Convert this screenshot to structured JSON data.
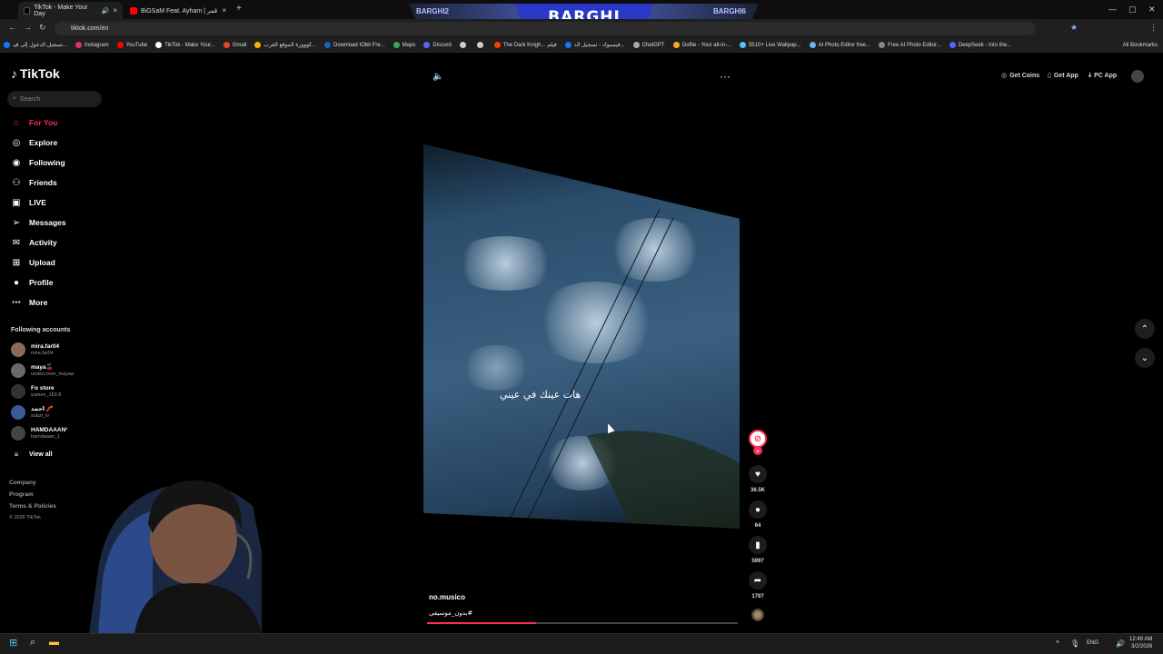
{
  "browser": {
    "tabs": [
      {
        "label": "TikTok - Make Your Day",
        "fav_color": "#111111"
      },
      {
        "label": "BiGSaM Feat. Ayham | يا قمر [Off...",
        "fav_color": "#ff0000"
      }
    ],
    "url": "tiktok.com/en",
    "bookmarks": [
      {
        "label": "تسجيل الدخول إلى فيـ...",
        "color": "#1877f2"
      },
      {
        "label": "Instagram",
        "color": "#e1306c"
      },
      {
        "label": "YouTube",
        "color": "#ff0000"
      },
      {
        "label": "TikTok - Make Your...",
        "color": "#ffffff"
      },
      {
        "label": "Gmail",
        "color": "#ea4335"
      },
      {
        "label": "كووورة الموقع العرب...",
        "color": "#f4b400"
      },
      {
        "label": "Download IObit Fre...",
        "color": "#1565c0"
      },
      {
        "label": "Maps",
        "color": "#34a853"
      },
      {
        "label": "Discord",
        "color": "#5865f2"
      },
      {
        "label": "",
        "color": "#cccccc"
      },
      {
        "label": "",
        "color": "#cccccc"
      },
      {
        "label": "The Dark Knigh... فيلم",
        "color": "#ff3d00"
      },
      {
        "label": "فيسبوك - تسجيل الد...",
        "color": "#1877f2"
      },
      {
        "label": "ChatGPT",
        "color": "#aaaaaa"
      },
      {
        "label": "Gofile - Your all-in-...",
        "color": "#f9a825"
      },
      {
        "label": "5510+ Live Wallpap...",
        "color": "#4fc3f7"
      },
      {
        "label": "AI Photo Editor free...",
        "color": "#64b5f6"
      },
      {
        "label": "Free AI Photo Editor...",
        "color": "#888888"
      },
      {
        "label": "DeepSeek - Into the...",
        "color": "#4d6bfe"
      }
    ],
    "all_bookmarks": "All Bookmarks"
  },
  "stream": {
    "center": "BARGHI",
    "left": "BARGHI2",
    "right": "BARGHI6"
  },
  "app": {
    "logo": "TikTok",
    "search_placeholder": "Search",
    "nav": [
      {
        "label": "For You",
        "icon": "home-icon"
      },
      {
        "label": "Explore",
        "icon": "compass-icon"
      },
      {
        "label": "Following",
        "icon": "following-icon"
      },
      {
        "label": "Friends",
        "icon": "friends-icon"
      },
      {
        "label": "LIVE",
        "icon": "live-icon"
      },
      {
        "label": "Messages",
        "icon": "messages-icon"
      },
      {
        "label": "Activity",
        "icon": "activity-icon"
      },
      {
        "label": "Upload",
        "icon": "upload-icon"
      },
      {
        "label": "Profile",
        "icon": "profile-icon"
      },
      {
        "label": "More",
        "icon": "more-icon"
      }
    ],
    "following_title": "Following accounts",
    "accounts": [
      {
        "name": "mira.far04",
        "handle": "mira.far04"
      },
      {
        "name": "maya🍒",
        "handle": "undercover_mayaa"
      },
      {
        "name": "Fo store",
        "handle": "yamen_163.8"
      },
      {
        "name": "احمد 🧨",
        "handle": "subzi_tv"
      },
      {
        "name": "HAMDAAAN¹",
        "handle": "hamdaaan_1"
      }
    ],
    "view_all": "View all",
    "footer": [
      "Company",
      "Program",
      "Terms & Policies",
      "© 2026 TikTok"
    ]
  },
  "topbar": {
    "get_coins": "Get Coins",
    "get_app": "Get App",
    "pc_app": "PC App"
  },
  "video": {
    "caption_overlay": "هات عينك في عيني",
    "author": "no.musico",
    "hashtag": "#بدون_موسيقى",
    "progress": 0.35,
    "likes": "36.5K",
    "comments": "64",
    "saves": "5997",
    "shares": "1797"
  },
  "taskbar": {
    "lang": "ENG",
    "time": "12:49 AM",
    "date": "3/2/2026"
  }
}
